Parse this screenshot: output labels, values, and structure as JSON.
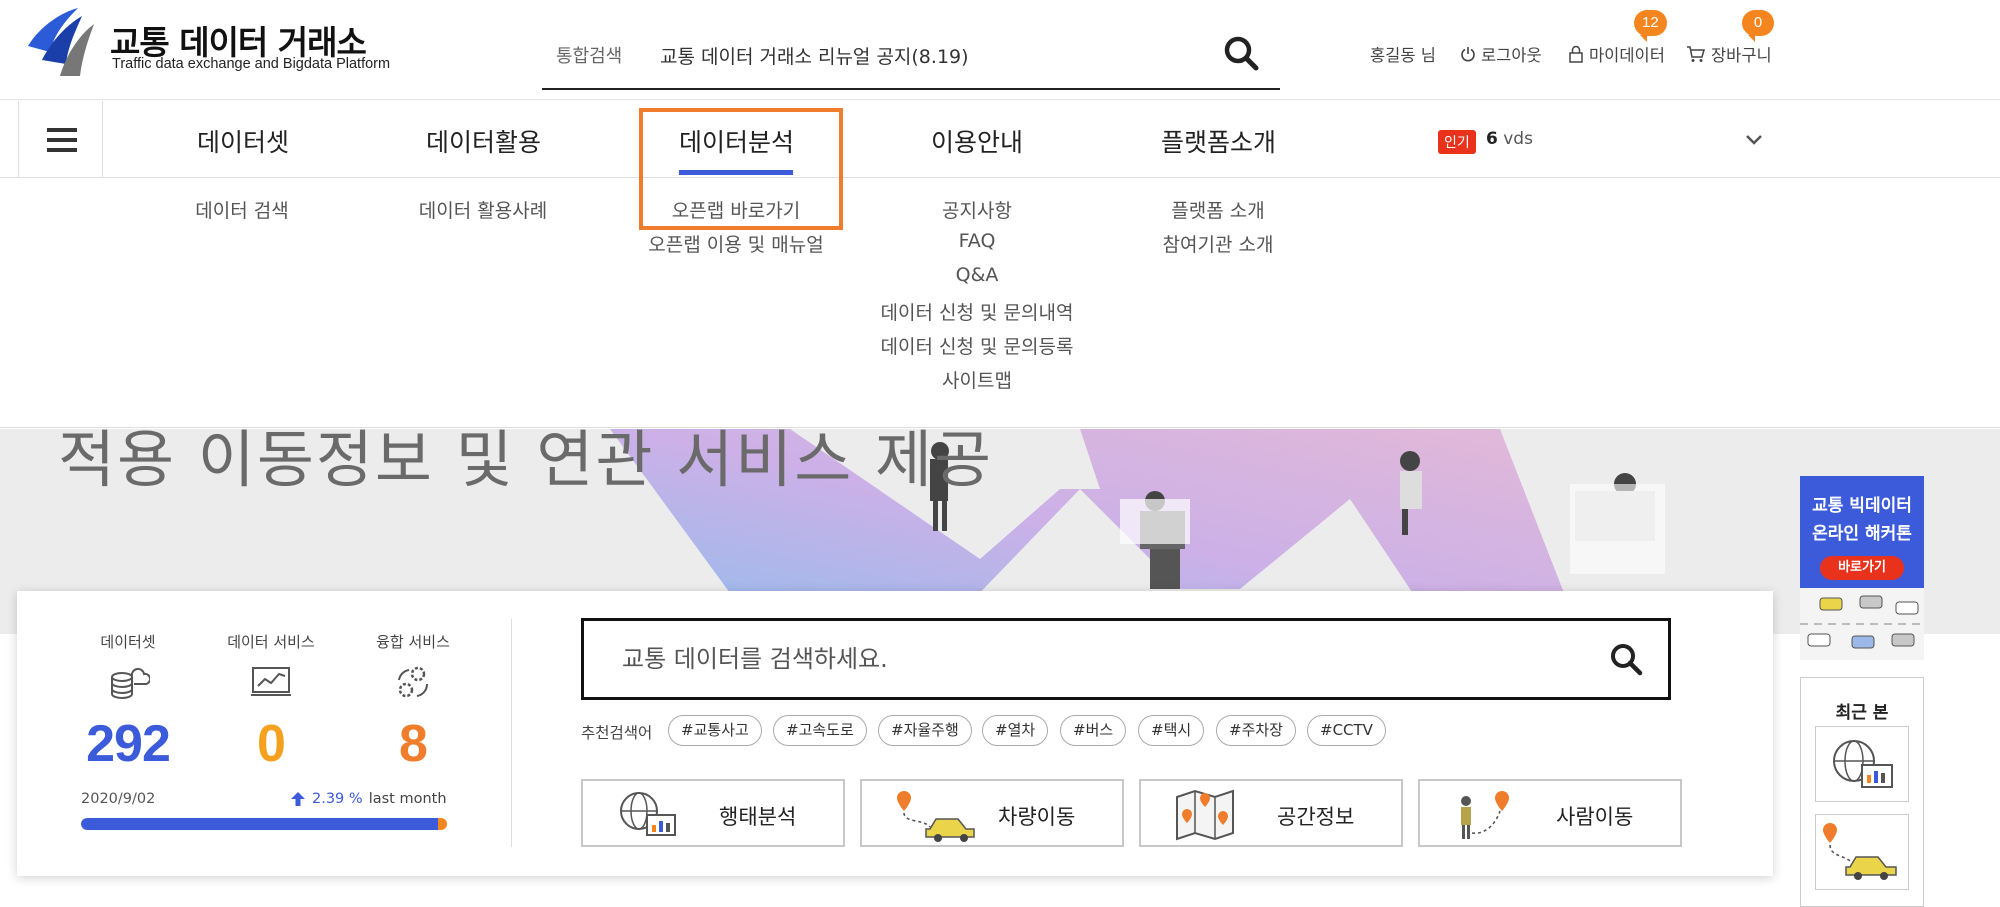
{
  "header": {
    "logo_title": "교통 데이터 거래소",
    "logo_subtitle": "Traffic data exchange and Bigdata Platform",
    "search_tab": "통합검색",
    "search_notice": "교통 데이터 거래소 리뉴얼 공지(8.19)",
    "user_name": "홍길동 님",
    "logout": "로그아웃",
    "my_data": "마이데이터",
    "my_data_count": "12",
    "cart": "장바구니",
    "cart_count": "0"
  },
  "gnb": {
    "items": [
      "데이터셋",
      "데이터활용",
      "데이터분석",
      "이용안내",
      "플랫폼소개"
    ],
    "active": "데이터분석",
    "hot_label": "인기",
    "hot_rank": "6",
    "hot_keyword": "vds"
  },
  "submenu": {
    "dataset": [
      "데이터 검색"
    ],
    "usage": [
      "데이터 활용사례"
    ],
    "analysis": [
      "오픈랩 바로가기",
      "오픈랩 이용 및 매뉴얼"
    ],
    "guide": [
      "공지사항",
      "FAQ",
      "Q&A",
      "데이터 신청 및 문의내역",
      "데이터 신청 및 문의등록",
      "사이트맵"
    ],
    "platform": [
      "플랫폼 소개",
      "참여기관 소개"
    ]
  },
  "banner": {
    "headline": "적용 이동정보 및 연관 서비스 제공"
  },
  "stats": {
    "items": [
      {
        "label": "데이터셋",
        "value": "292",
        "color": "#3b5bdb"
      },
      {
        "label": "데이터 서비스",
        "value": "0",
        "color": "#f5a11f"
      },
      {
        "label": "융합 서비스",
        "value": "8",
        "color": "#f07d2c"
      }
    ],
    "date": "2020/9/02",
    "growth_pct": "2.39 %",
    "growth_period": "last month",
    "progress": 0.98
  },
  "search": {
    "placeholder": "교통 데이터를 검색하세요.",
    "recommend_label": "추천검색어",
    "tags": [
      "#교통사고",
      "#고속도로",
      "#자율주행",
      "#열차",
      "#버스",
      "#택시",
      "#주차장",
      "#CCTV"
    ]
  },
  "categories": [
    "행태분석",
    "차량이동",
    "공간정보",
    "사람이동"
  ],
  "side": {
    "ad_line1": "교통 빅데이터",
    "ad_line2": "온라인 해커톤",
    "ad_button": "바로가기",
    "recent_title": "최근 본"
  },
  "colors": {
    "accent": "#3b5bdb",
    "orange": "#f5851f",
    "highlight": "#f07d2c",
    "hot": "#e8321c"
  }
}
